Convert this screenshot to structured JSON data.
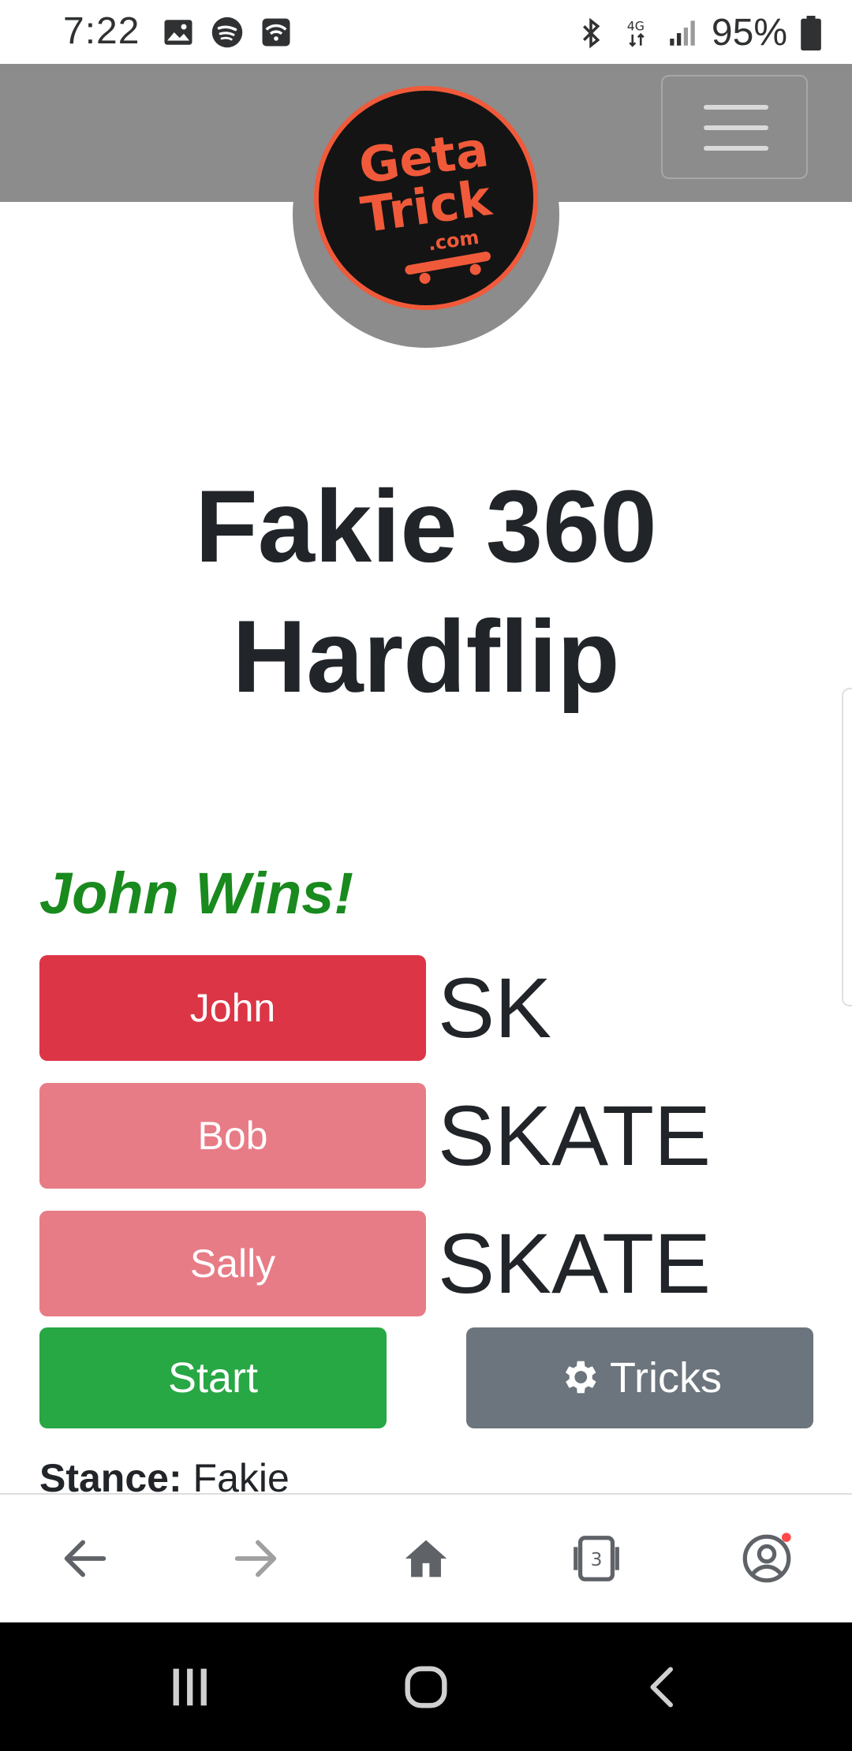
{
  "status_bar": {
    "time": "7:22",
    "network": "4G",
    "battery": "95%"
  },
  "header": {
    "logo_lines": [
      "Geta",
      "Trick",
      ".com"
    ],
    "menu_icon": "hamburger-menu-icon"
  },
  "main": {
    "title_line1": "Fakie 360",
    "title_line2": "Hardflip",
    "winner_text": "John Wins!",
    "players": [
      {
        "name": "John",
        "letters": "SK"
      },
      {
        "name": "Bob",
        "letters": "SKATE"
      },
      {
        "name": "Sally",
        "letters": "SKATE"
      }
    ],
    "start_label": "Start",
    "tricks_label": "Tricks",
    "stance_label": "Stance:",
    "stance_value": "Fakie"
  },
  "browser_bar": {
    "tab_count": "3"
  },
  "colors": {
    "header": "#8c8c8c",
    "active_player": "#dc3545",
    "inactive_player": "#e77c86",
    "start": "#28a745",
    "tricks": "#6c757d",
    "winner": "#198a1e",
    "logo_accent": "#f05a3a"
  }
}
